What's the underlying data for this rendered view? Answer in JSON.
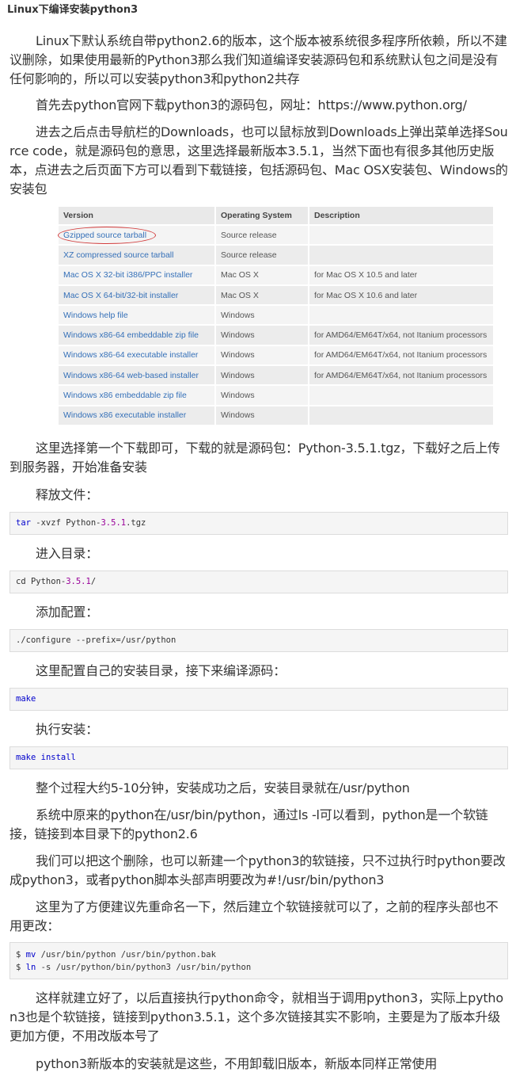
{
  "title": "Linux下编译安装python3",
  "paragraphs": {
    "p1": "Linux下默认系统自带python2.6的版本，这个版本被系统很多程序所依赖，所以不建议删除，如果使用最新的Python3那么我们知道编译安装源码包和系统默认包之间是没有任何影响的，所以可以安装python3和python2共存",
    "p2": "首先去python官网下载python3的源码包，网址：https://www.python.org/",
    "p3": "进去之后点击导航栏的Downloads，也可以鼠标放到Downloads上弹出菜单选择Source code，就是源码包的意思，这里选择最新版本3.5.1，当然下面也有很多其他历史版本，点进去之后页面下方可以看到下载链接，包括源码包、Mac OSX安装包、Windows的安装包",
    "p4": "这里选择第一个下载即可，下载的就是源码包：Python-3.5.1.tgz，下载好之后上传到服务器，开始准备安装",
    "p5": "释放文件：",
    "p6": "进入目录：",
    "p7": "添加配置：",
    "p8": "这里配置自己的安装目录，接下来编译源码：",
    "p9": "执行安装：",
    "p10": "整个过程大约5-10分钟，安装成功之后，安装目录就在/usr/python",
    "p11": "系统中原来的python在/usr/bin/python，通过ls -l可以看到，python是一个软链接，链接到本目录下的python2.6",
    "p12": "我们可以把这个删除，也可以新建一个python3的软链接，只不过执行时python要改成python3，或者python脚本头部声明要改为#!/usr/bin/python3",
    "p13": "这里为了方便建议先重命名一下，然后建立个软链接就可以了，之前的程序头部也不用更改：",
    "p14": "这样就建立好了，以后直接执行python命令，就相当于调用python3，实际上python3也是个软链接，链接到python3.5.1，这个多次链接其实不影响，主要是为了版本升级更加方便，不用改版本号了",
    "p15": "python3新版本的安装就是这些，不用卸载旧版本，新版本同样正常使用"
  },
  "download_table": {
    "headers": [
      "Version",
      "Operating System",
      "Description"
    ],
    "rows": [
      {
        "version": "Gzipped source tarball",
        "os": "Source release",
        "desc": ""
      },
      {
        "version": "XZ compressed source tarball",
        "os": "Source release",
        "desc": ""
      },
      {
        "version": "Mac OS X 32-bit i386/PPC installer",
        "os": "Mac OS X",
        "desc": "for Mac OS X 10.5 and later"
      },
      {
        "version": "Mac OS X 64-bit/32-bit installer",
        "os": "Mac OS X",
        "desc": "for Mac OS X 10.6 and later"
      },
      {
        "version": "Windows help file",
        "os": "Windows",
        "desc": ""
      },
      {
        "version": "Windows x86-64 embeddable zip file",
        "os": "Windows",
        "desc": "for AMD64/EM64T/x64, not Itanium processors"
      },
      {
        "version": "Windows x86-64 executable installer",
        "os": "Windows",
        "desc": "for AMD64/EM64T/x64, not Itanium processors"
      },
      {
        "version": "Windows x86-64 web-based installer",
        "os": "Windows",
        "desc": "for AMD64/EM64T/x64, not Itanium processors"
      },
      {
        "version": "Windows x86 embeddable zip file",
        "os": "Windows",
        "desc": ""
      },
      {
        "version": "Windows x86 executable installer",
        "os": "Windows",
        "desc": ""
      }
    ]
  },
  "code": {
    "tar_cmd": "tar",
    "tar_args": " -xvzf Python-",
    "tar_ver": "3.5.1",
    "tar_ext": ".tgz",
    "cd_cmd": "cd Python-",
    "cd_ver": "3.5.1",
    "cd_tail": "/",
    "configure": "./configure --prefix=/usr/python",
    "make": "make",
    "make_install_1": "make",
    "make_install_2": "install",
    "ln1_prompt": "$ ",
    "ln1_cmd": "mv",
    "ln1_args": " /usr/bin/python /usr/bin/python.bak",
    "ln2_prompt": "$ ",
    "ln2_cmd": "ln",
    "ln2_args": " -s /usr/python/bin/python3 /usr/bin/python"
  }
}
